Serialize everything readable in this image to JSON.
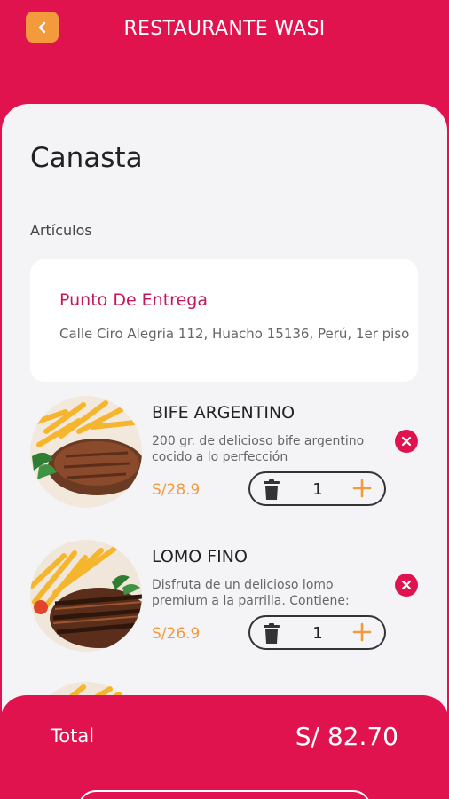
{
  "header": {
    "title": "RESTAURANTE WASI",
    "back_icon": "chevron-left-icon"
  },
  "page": {
    "title": "Canasta",
    "subtitle": "Artículos"
  },
  "delivery": {
    "title": "Punto De Entrega",
    "address": "Calle Ciro Alegria 112, Huacho 15136, Perú, 1er piso"
  },
  "items": [
    {
      "name": "BIFE ARGENTINO",
      "description": "200 gr. de delicioso bife argentino cocido a lo perfección",
      "price": "S/28.9",
      "quantity": "1"
    },
    {
      "name": "LOMO FINO",
      "description": "Disfruta de un delicioso lomo premium a la parrilla. Contiene:",
      "price": "S/26.9",
      "quantity": "1"
    }
  ],
  "footer": {
    "total_label": "Total",
    "total_value": "S/ 82.70"
  },
  "colors": {
    "brand": "#e0134f",
    "accent": "#f39a3c",
    "background": "#f4f4f6"
  }
}
